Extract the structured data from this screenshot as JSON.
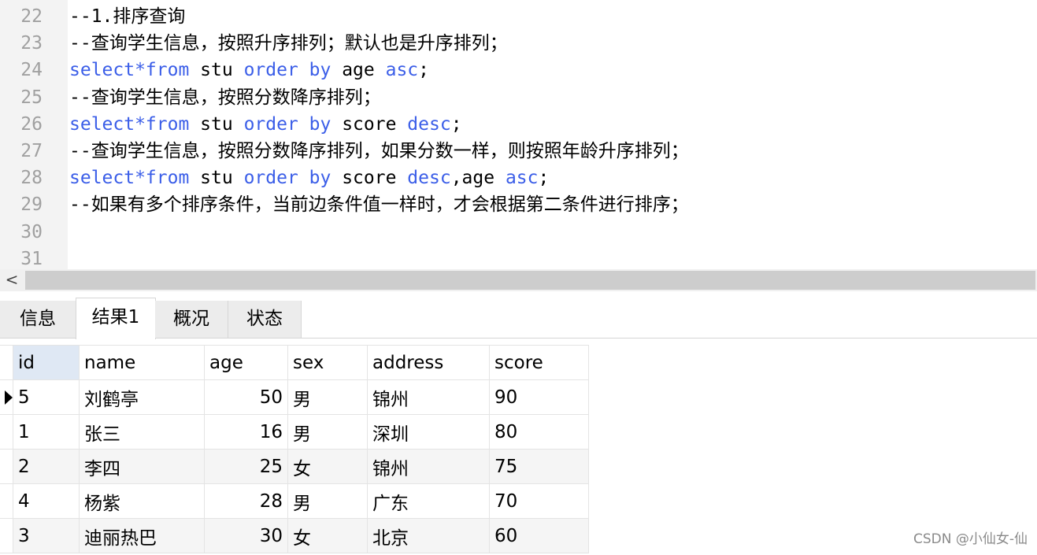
{
  "editor": {
    "lines": [
      {
        "num": "22",
        "segments": [
          {
            "t": "--1.排序查询",
            "k": "cm"
          }
        ]
      },
      {
        "num": "23",
        "segments": [
          {
            "t": "--查询学生信息，按照升序排列；默认也是升序排列；",
            "k": "cm"
          }
        ]
      },
      {
        "num": "24",
        "segments": [
          {
            "t": "select*from",
            "k": "kw"
          },
          {
            "t": " stu ",
            "k": "tx"
          },
          {
            "t": "order by",
            "k": "kw"
          },
          {
            "t": " age ",
            "k": "tx"
          },
          {
            "t": "asc",
            "k": "kw"
          },
          {
            "t": ";",
            "k": "tx"
          }
        ]
      },
      {
        "num": "25",
        "segments": [
          {
            "t": "--查询学生信息，按照分数降序排列；",
            "k": "cm"
          }
        ]
      },
      {
        "num": "26",
        "segments": [
          {
            "t": "select*from",
            "k": "kw"
          },
          {
            "t": " stu ",
            "k": "tx"
          },
          {
            "t": "order by",
            "k": "kw"
          },
          {
            "t": " score ",
            "k": "tx"
          },
          {
            "t": "desc",
            "k": "kw"
          },
          {
            "t": ";",
            "k": "tx"
          }
        ]
      },
      {
        "num": "27",
        "segments": [
          {
            "t": "--查询学生信息，按照分数降序排列，如果分数一样，则按照年龄升序排列；",
            "k": "cm"
          }
        ]
      },
      {
        "num": "28",
        "segments": [
          {
            "t": "select*from",
            "k": "kw"
          },
          {
            "t": " stu ",
            "k": "tx"
          },
          {
            "t": "order by",
            "k": "kw"
          },
          {
            "t": " score ",
            "k": "tx"
          },
          {
            "t": "desc",
            "k": "kw"
          },
          {
            "t": ",age ",
            "k": "tx"
          },
          {
            "t": "asc",
            "k": "kw"
          },
          {
            "t": ";",
            "k": "tx"
          }
        ]
      },
      {
        "num": "29",
        "segments": [
          {
            "t": "--如果有多个排序条件，当前边条件值一样时，才会根据第二条件进行排序；",
            "k": "cm"
          }
        ]
      },
      {
        "num": "30",
        "segments": []
      },
      {
        "num": "31",
        "segments": []
      }
    ],
    "keyword_color": "#3b5ee8"
  },
  "scrollbar": {
    "left_arrow": "<"
  },
  "tabs": [
    {
      "label": "信息",
      "active": false
    },
    {
      "label": "结果1",
      "active": true
    },
    {
      "label": "概况",
      "active": false
    },
    {
      "label": "状态",
      "active": false
    }
  ],
  "results": {
    "columns": [
      "id",
      "name",
      "age",
      "sex",
      "address",
      "score"
    ],
    "rows": [
      [
        "5",
        "刘鹤亭",
        "50",
        "男",
        "锦州",
        "90"
      ],
      [
        "1",
        "张三",
        "16",
        "男",
        "深圳",
        "80"
      ],
      [
        "2",
        "李四",
        "25",
        "女",
        "锦州",
        "75"
      ],
      [
        "4",
        "杨紫",
        "28",
        "男",
        "广东",
        "70"
      ],
      [
        "3",
        "迪丽热巴",
        "30",
        "女",
        "北京",
        "60"
      ]
    ],
    "current_row": 0
  },
  "watermark": "CSDN @小仙女-仙"
}
